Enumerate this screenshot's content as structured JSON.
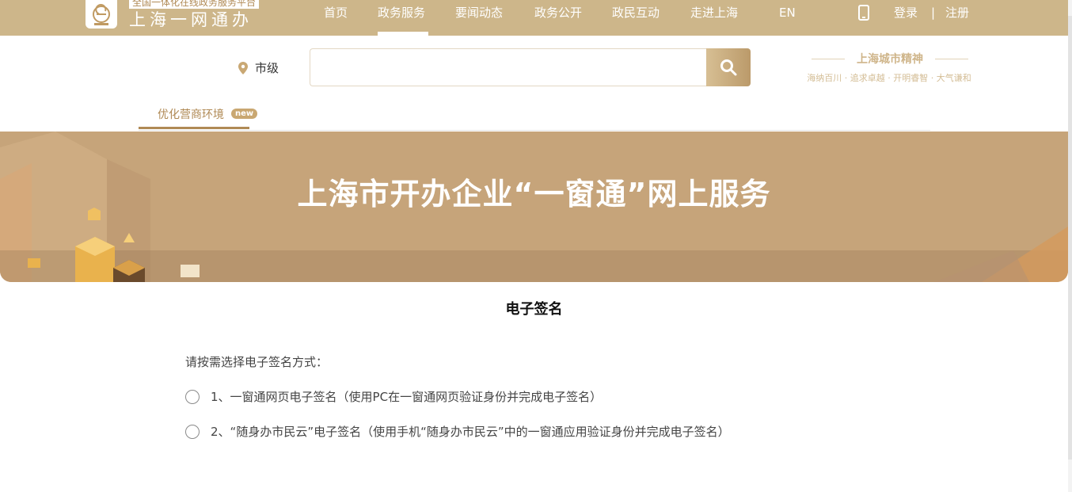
{
  "header": {
    "logo_subtitle": "全国一体化在线政务服务平台",
    "logo_title": "上海一网通办",
    "nav": [
      "首页",
      "政务服务",
      "要闻动态",
      "政务公开",
      "政民互动",
      "走进上海",
      "EN"
    ],
    "active_nav_index": 1,
    "login": "登录",
    "separator": "|",
    "register": "注册",
    "icons": [
      "logo-emblem-icon",
      "phone-icon"
    ]
  },
  "search": {
    "location": "市级",
    "location_icon": "map-pin-icon",
    "value": "",
    "placeholder": "",
    "button_icon": "search-icon"
  },
  "city_spirit": {
    "title": "上海城市精神",
    "subtitle": "海纳百川 · 追求卓越 · 开明睿智 · 大气谦和"
  },
  "subnav": {
    "tab": "优化营商环境",
    "badge": "new"
  },
  "banner": {
    "title": "上海市开办企业“一窗通”网上服务"
  },
  "main": {
    "heading": "电子签名",
    "prompt": "请按需选择电子签名方式：",
    "options": [
      {
        "label": "1、一窗通网页电子签名（使用PC在一窗通网页验证身份并完成电子签名）",
        "selected": false
      },
      {
        "label": "2、“随身办市民云”电子签名（使用手机“随身办市民云”中的一窗通应用验证身份并完成电子签名）",
        "selected": false
      }
    ]
  },
  "colors": {
    "brand_gold": "#cdb68a",
    "banner": "#c6a47a",
    "accent_text": "#b08a55"
  }
}
